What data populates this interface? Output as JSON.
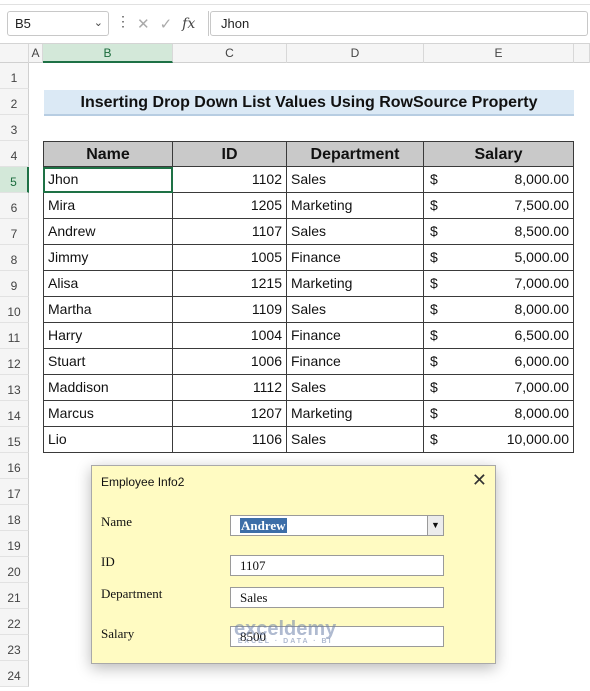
{
  "formula_bar": {
    "name_box": "B5",
    "formula": "Jhon"
  },
  "columns": [
    "A",
    "B",
    "C",
    "D",
    "E"
  ],
  "rows": [
    "1",
    "2",
    "3",
    "4",
    "5",
    "6",
    "7",
    "8",
    "9",
    "10",
    "11",
    "12",
    "13",
    "14",
    "15",
    "16",
    "17",
    "18",
    "19",
    "20",
    "21",
    "22",
    "23",
    "24"
  ],
  "title": "Inserting Drop Down List Values Using RowSource Property",
  "table": {
    "headers": [
      "Name",
      "ID",
      "Department",
      "Salary"
    ],
    "currency_symbol": "$",
    "rows": [
      [
        "Jhon",
        "1102",
        "Sales",
        "8,000.00"
      ],
      [
        "Mira",
        "1205",
        "Marketing",
        "7,500.00"
      ],
      [
        "Andrew",
        "1107",
        "Sales",
        "8,500.00"
      ],
      [
        "Jimmy",
        "1005",
        "Finance",
        "5,000.00"
      ],
      [
        "Alisa",
        "1215",
        "Marketing",
        "7,000.00"
      ],
      [
        "Martha",
        "1109",
        "Sales",
        "8,000.00"
      ],
      [
        "Harry",
        "1004",
        "Finance",
        "6,500.00"
      ],
      [
        "Stuart",
        "1006",
        "Finance",
        "6,000.00"
      ],
      [
        "Maddison",
        "1112",
        "Sales",
        "7,000.00"
      ],
      [
        "Marcus",
        "1207",
        "Marketing",
        "8,000.00"
      ],
      [
        "Lio",
        "1106",
        "Sales",
        "10,000.00"
      ]
    ]
  },
  "dialog": {
    "title": "Employee Info2",
    "name_label": "Name",
    "name_value": "Andrew",
    "id_label": "ID",
    "id_value": "1107",
    "dept_label": "Department",
    "dept_value": "Sales",
    "salary_label": "Salary",
    "salary_value": "8500"
  },
  "watermark": {
    "brand": "exceldemy",
    "tagline": "EXCEL · DATA · BI"
  },
  "colors": {
    "selection": "#1e7145",
    "header_fill": "#c9c9c9",
    "title_fill": "#dbe9f5",
    "dialog_bg": "#fffbc2"
  }
}
